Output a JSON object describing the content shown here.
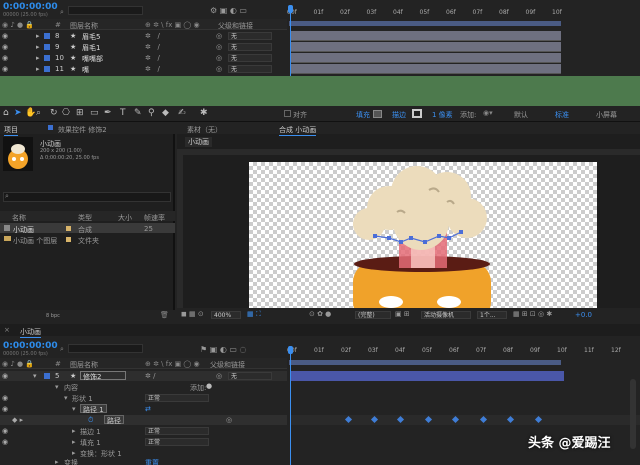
{
  "top_timeline": {
    "timecode": "0:00:00:00",
    "sub_timecode": "00000 (25.00 fps)",
    "col_layer_name": "图层名称",
    "col_parent": "父级和链接",
    "layers": [
      {
        "num": "8",
        "name": "眉毛5",
        "parent": "无"
      },
      {
        "num": "9",
        "name": "眉毛1",
        "parent": "无"
      },
      {
        "num": "10",
        "name": "嘴嘴部",
        "parent": "无"
      },
      {
        "num": "11",
        "name": "嘴",
        "parent": "无"
      }
    ],
    "ruler": [
      "00f",
      "01f",
      "02f",
      "03f",
      "04f",
      "05f",
      "06f",
      "07f",
      "08f",
      "09f",
      "10f"
    ]
  },
  "toolbar": {
    "align_label": "对齐",
    "fill_label": "填充",
    "stroke_label": "描边",
    "stroke_px": "1 像素",
    "add_label": "添加:",
    "workspace_default": "默认",
    "workspace_standard": "标准",
    "workspace_small": "小屏幕"
  },
  "project_panel": {
    "tab_project": "项目",
    "tab_effects": "效果控件 修饰2",
    "comp_name": "小动画",
    "comp_size": "200 x 200 (1.00)",
    "comp_duration": "Δ 0;00:00:20, 25.00 fps",
    "col_name": "名称",
    "col_type": "类型",
    "col_size": "大小",
    "col_fps": "帧速率",
    "items": [
      {
        "name": "小动画",
        "type": "合成",
        "fps": "25"
      },
      {
        "name": "小动画 个图层",
        "type": "文件夹",
        "fps": ""
      }
    ],
    "bpc": "8 bpc"
  },
  "comp_panel": {
    "tab_footage": "素材（无）",
    "tab_comp": "合成 小动画",
    "comp_label": "小动画",
    "zoom": "400%",
    "quality": "(完整)",
    "camera": "活动摄像机",
    "view": "1个...",
    "exposure": "+0.0"
  },
  "bottom_timeline": {
    "tab": "小动画",
    "timecode": "0:00:00:00",
    "sub_timecode": "00000 (25.00 fps)",
    "col_layer_name": "图层名称",
    "col_parent": "父级和链接",
    "layer": {
      "num": "5",
      "name": "修饰2",
      "parent": "无"
    },
    "contents_label": "内容",
    "add_label": "添加:",
    "shape1": "形状 1",
    "shape1_mode": "正常",
    "path1": "路径 1",
    "path_prop": "路径",
    "stroke1": "描边 1",
    "stroke_mode": "正常",
    "fill1": "填充 1",
    "fill_mode": "正常",
    "transform_shape": "变换：形状 1",
    "transform": "变换",
    "reset": "重置",
    "ruler": [
      "00f",
      "01f",
      "02f",
      "03f",
      "04f",
      "05f",
      "06f",
      "07f",
      "08f",
      "09f",
      "10f",
      "11f",
      "12f"
    ]
  },
  "watermark": {
    "text": "头条 @爱踢汪"
  }
}
